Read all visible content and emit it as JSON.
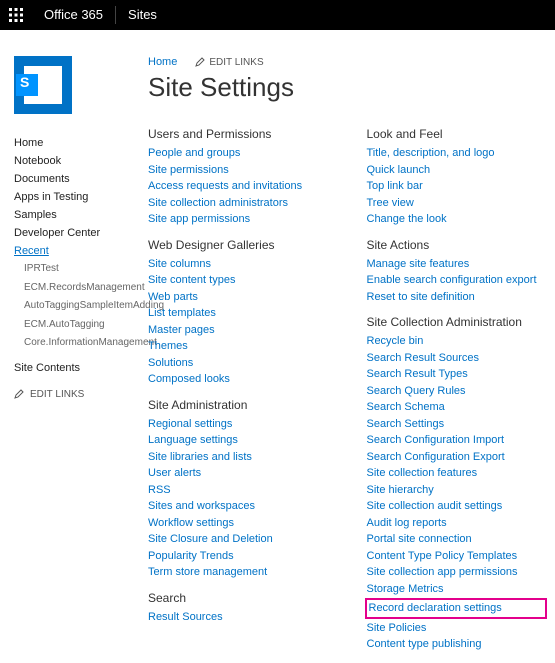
{
  "suite": {
    "office": "Office 365",
    "sites": "Sites"
  },
  "breadcrumb": {
    "home": "Home",
    "editlinks": "EDIT LINKS"
  },
  "page": {
    "title": "Site Settings"
  },
  "ql": {
    "items": [
      {
        "label": "Home"
      },
      {
        "label": "Notebook"
      },
      {
        "label": "Documents"
      },
      {
        "label": "Apps in Testing"
      },
      {
        "label": "Samples"
      },
      {
        "label": "Developer Center"
      }
    ],
    "recentHeader": "Recent",
    "recent": [
      {
        "label": "IPRTest"
      },
      {
        "label": "ECM.RecordsManagement"
      },
      {
        "label": "AutoTaggingSampleItemAdding"
      },
      {
        "label": "ECM.AutoTagging"
      },
      {
        "label": "Core.InformationManagement"
      }
    ],
    "siteContents": "Site Contents",
    "editlinks": "EDIT LINKS"
  },
  "siteicon": {
    "letter": "S"
  },
  "settings": {
    "col1": [
      {
        "heading": "Users and Permissions",
        "links": [
          "People and groups",
          "Site permissions",
          "Access requests and invitations",
          "Site collection administrators",
          "Site app permissions"
        ]
      },
      {
        "heading": "Web Designer Galleries",
        "links": [
          "Site columns",
          "Site content types",
          "Web parts",
          "List templates",
          "Master pages",
          "Themes",
          "Solutions",
          "Composed looks"
        ]
      },
      {
        "heading": "Site Administration",
        "links": [
          "Regional settings",
          "Language settings",
          "Site libraries and lists",
          "User alerts",
          "RSS",
          "Sites and workspaces",
          "Workflow settings",
          "Site Closure and Deletion",
          "Popularity Trends",
          "Term store management"
        ]
      },
      {
        "heading": "Search",
        "links": [
          "Result Sources"
        ]
      }
    ],
    "col2": [
      {
        "heading": "Look and Feel",
        "links": [
          "Title, description, and logo",
          "Quick launch",
          "Top link bar",
          "Tree view",
          "Change the look"
        ]
      },
      {
        "heading": "Site Actions",
        "links": [
          "Manage site features",
          "Enable search configuration export",
          "Reset to site definition"
        ]
      },
      {
        "heading": "Site Collection Administration",
        "links": [
          "Recycle bin",
          "Search Result Sources",
          "Search Result Types",
          "Search Query Rules",
          "Search Schema",
          "Search Settings",
          "Search Configuration Import",
          "Search Configuration Export",
          "Site collection features",
          "Site hierarchy",
          "Site collection audit settings",
          "Audit log reports",
          "Portal site connection",
          "Content Type Policy Templates",
          "Site collection app permissions",
          "Storage Metrics",
          "Record declaration settings",
          "Site Policies",
          "Content type publishing"
        ],
        "highlightIndex": 16
      }
    ]
  }
}
